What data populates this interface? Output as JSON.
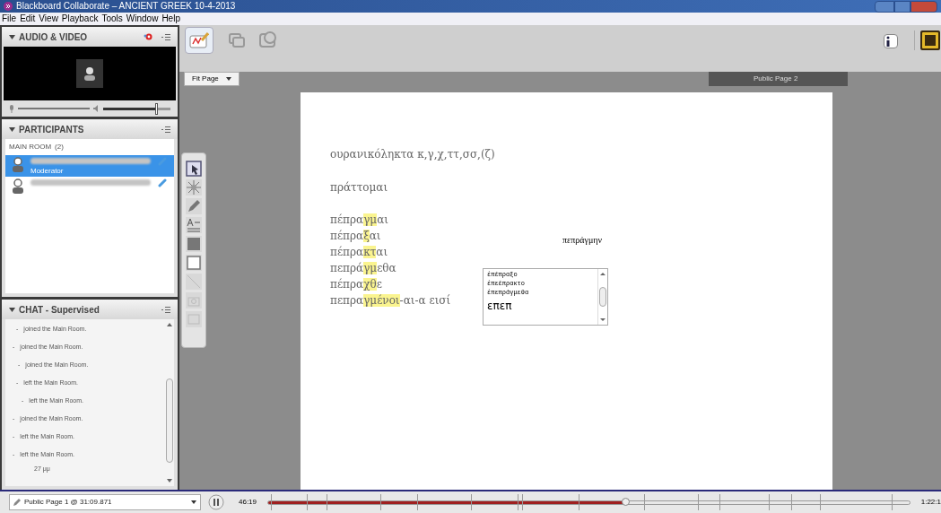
{
  "window": {
    "title": "Blackboard Collaborate – ANCIENT GREEK 10-4-2013"
  },
  "menu": [
    "File",
    "Edit",
    "View",
    "Playback",
    "Tools",
    "Window",
    "Help"
  ],
  "audio_video": {
    "title": "AUDIO & VIDEO",
    "volume": {
      "level": 0.8
    }
  },
  "participants": {
    "title": "PARTICIPANTS",
    "room": "MAIN ROOM",
    "count": "(2)",
    "items": [
      {
        "role": "Moderator",
        "selected": true
      },
      {
        "selected": false
      }
    ]
  },
  "chat": {
    "title": "CHAT - Supervised",
    "messages": [
      {
        "prefix": "-",
        "text": "joined the Main Room."
      },
      {
        "prefix": "-",
        "text": "joined the Main Room."
      },
      {
        "prefix": "-",
        "text": "joined the Main Room."
      },
      {
        "prefix": "-",
        "text": "left the Main Room."
      },
      {
        "prefix": "-",
        "text": "left the Main Room."
      },
      {
        "prefix": "-",
        "text": "joined the Main Room."
      },
      {
        "prefix": "-",
        "text": "left the Main Room."
      },
      {
        "prefix": "-",
        "text": "left the Main Room."
      }
    ],
    "time": "27 μμ"
  },
  "view": {
    "zoom": "Fit Page",
    "page_tab": "Public Page 2"
  },
  "whiteboard": {
    "heading": "ουρανικόληκτα κ,γ,χ,ττ,σσ,(ζ)",
    "verb": "πράττομαι",
    "forms": [
      [
        {
          "text": "πέπρα",
          "highlighted": false
        },
        {
          "text": "γμ",
          "highlighted": true
        },
        {
          "text": "αι",
          "highlighted": false
        }
      ],
      [
        {
          "text": "πέπρα",
          "highlighted": false
        },
        {
          "text": "ξ",
          "highlighted": true
        },
        {
          "text": "αι",
          "highlighted": false
        }
      ],
      [
        {
          "text": "πέπρα",
          "highlighted": false
        },
        {
          "text": "κτ",
          "highlighted": true
        },
        {
          "text": "αι",
          "highlighted": false
        }
      ],
      [
        {
          "text": "πεπρά",
          "highlighted": false
        },
        {
          "text": "γμ",
          "highlighted": true
        },
        {
          "text": "εθα",
          "highlighted": false
        }
      ],
      [
        {
          "text": "πέπρα",
          "highlighted": false
        },
        {
          "text": "χθ",
          "highlighted": true
        },
        {
          "text": "ε",
          "highlighted": false
        }
      ],
      [
        {
          "text": "πεπρα",
          "highlighted": false
        },
        {
          "text": "γμένοι",
          "highlighted": true
        },
        {
          "text": "-αι-α εισί",
          "highlighted": false
        }
      ]
    ],
    "side_note": "πεπράγμην",
    "text_box": {
      "lines": [
        "ἐπέπραξο",
        "ἐπεέπρακτο",
        "ἐπεπράγμεθα"
      ],
      "typed": "επεπ"
    }
  },
  "playback": {
    "page": "Public Page 1 @ 31:09.871",
    "elapsed": "46:19",
    "level": 0.557,
    "total": "1:22:1"
  }
}
